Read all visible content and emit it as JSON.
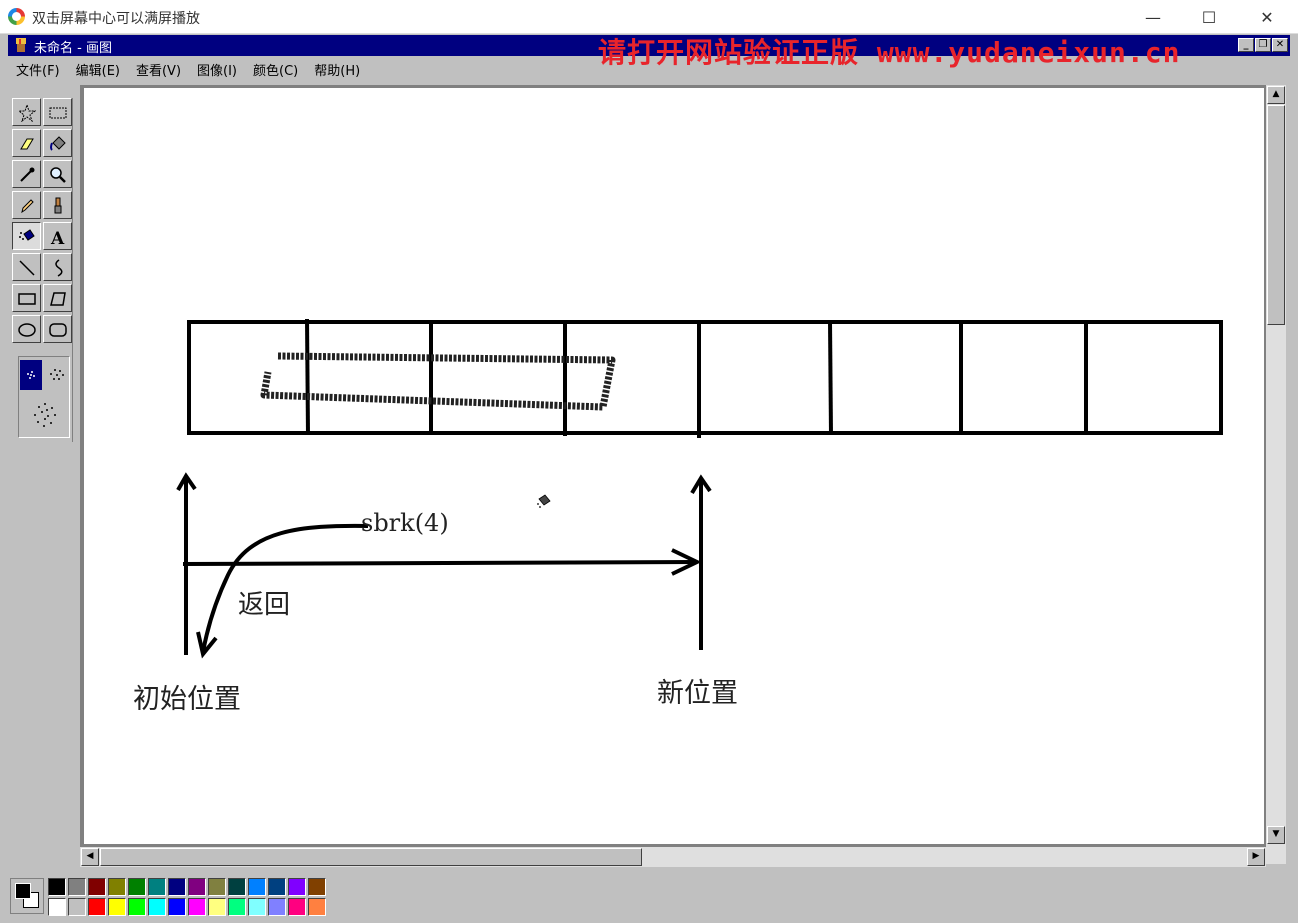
{
  "player": {
    "title": "双击屏幕中心可以满屏播放",
    "controls": {
      "minimize": "—",
      "maximize": "☐",
      "close": "✕"
    }
  },
  "app": {
    "title": "未命名 - 画图",
    "watermark": "请打开网站验证正版 www.yudaneixun.cn",
    "mdi": {
      "minimize": "_",
      "restore": "❐",
      "close": "✕"
    },
    "menu": [
      "文件(F)",
      "编辑(E)",
      "查看(V)",
      "图像(I)",
      "颜色(C)",
      "帮助(H)"
    ]
  },
  "tools": [
    {
      "name": "free-select",
      "icon": "star-select-icon"
    },
    {
      "name": "rect-select",
      "icon": "rect-select-icon"
    },
    {
      "name": "eraser",
      "icon": "eraser-icon"
    },
    {
      "name": "fill",
      "icon": "paint-bucket-icon"
    },
    {
      "name": "pick-color",
      "icon": "eyedropper-icon"
    },
    {
      "name": "magnifier",
      "icon": "magnifier-icon"
    },
    {
      "name": "pencil",
      "icon": "pencil-icon"
    },
    {
      "name": "brush",
      "icon": "brush-icon"
    },
    {
      "name": "airbrush",
      "icon": "airbrush-icon",
      "active": true
    },
    {
      "name": "text",
      "icon": "text-icon",
      "label": "A"
    },
    {
      "name": "line",
      "icon": "line-icon"
    },
    {
      "name": "curve",
      "icon": "curve-icon"
    },
    {
      "name": "rectangle",
      "icon": "rectangle-icon"
    },
    {
      "name": "polygon",
      "icon": "polygon-icon"
    },
    {
      "name": "ellipse",
      "icon": "ellipse-icon"
    },
    {
      "name": "rounded-rect",
      "icon": "rounded-rect-icon"
    }
  ],
  "canvas": {
    "labels": {
      "sbrk": "sbrk(4)",
      "return": "返回",
      "initial": "初始位置",
      "new": "新位置"
    }
  },
  "palette": {
    "top": [
      "#000000",
      "#808080",
      "#800000",
      "#808000",
      "#008000",
      "#008080",
      "#000080",
      "#800080",
      "#808040",
      "#004040",
      "#0080ff",
      "#004080",
      "#8000ff",
      "#804000"
    ],
    "bottom": [
      "#ffffff",
      "#c0c0c0",
      "#ff0000",
      "#ffff00",
      "#00ff00",
      "#00ffff",
      "#0000ff",
      "#ff00ff",
      "#ffff80",
      "#00ff80",
      "#80ffff",
      "#8080ff",
      "#ff0080",
      "#ff8040"
    ],
    "foreground": "#000000",
    "background": "#ffffff"
  }
}
